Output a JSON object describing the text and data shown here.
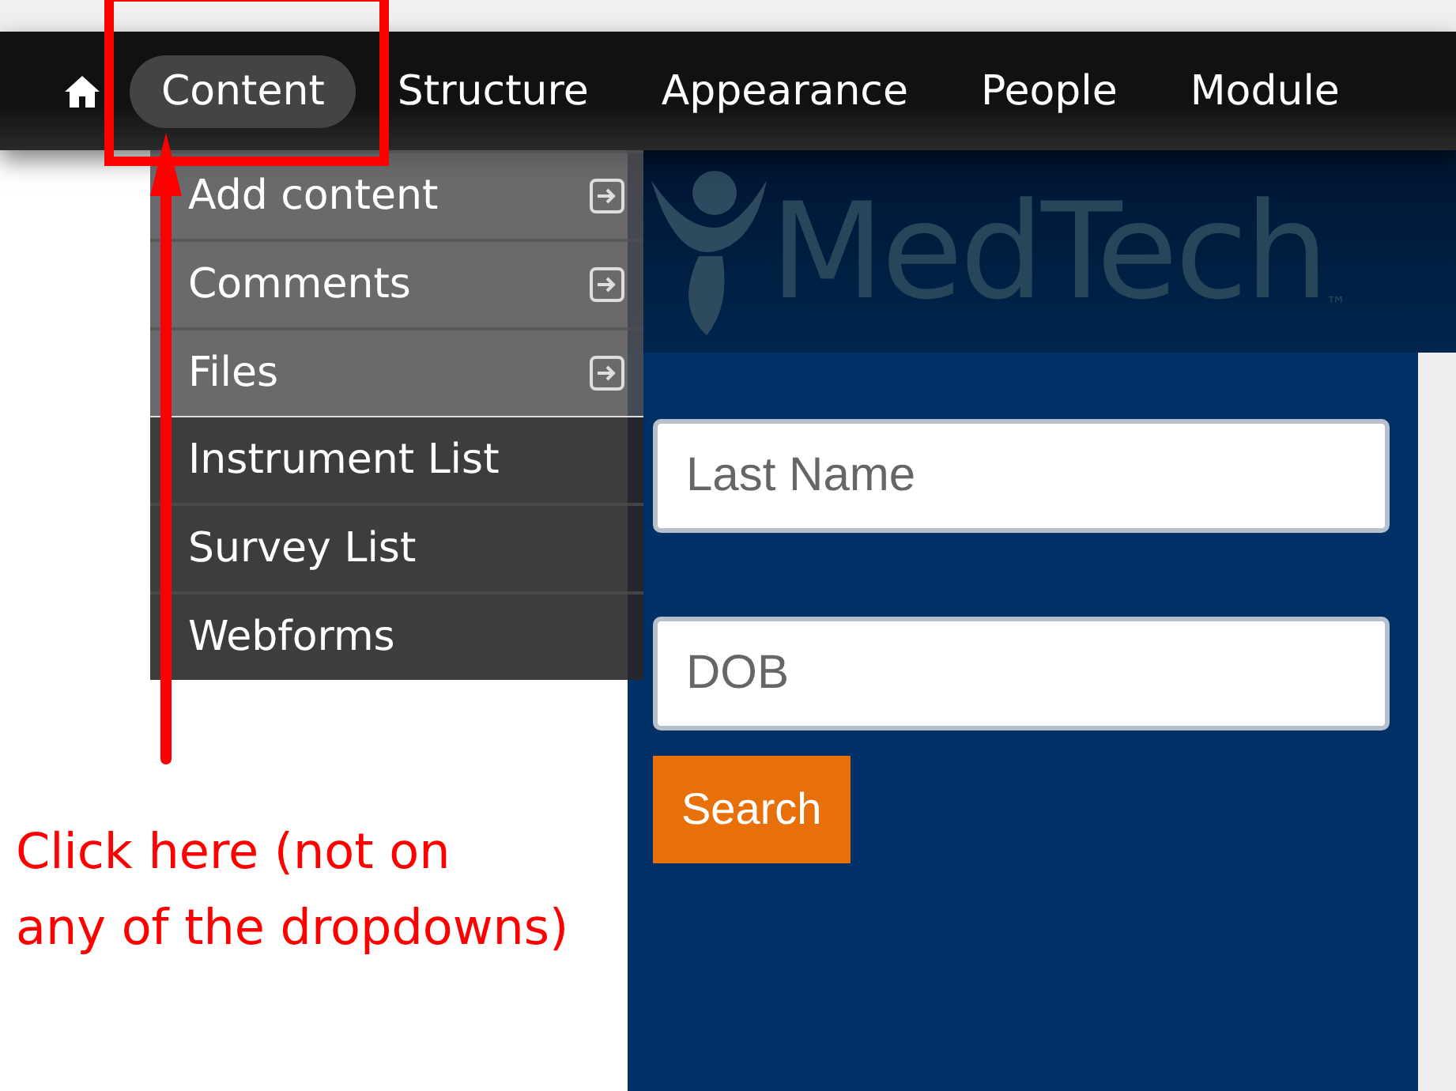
{
  "toolbar": {
    "items": [
      {
        "label": "Content",
        "selected": true
      },
      {
        "label": "Structure",
        "selected": false
      },
      {
        "label": "Appearance",
        "selected": false
      },
      {
        "label": "People",
        "selected": false
      },
      {
        "label": "Module",
        "selected": false
      }
    ]
  },
  "dropdown": {
    "items": [
      {
        "label": "Add content",
        "kind": "expandable"
      },
      {
        "label": "Comments",
        "kind": "expandable"
      },
      {
        "label": "Files",
        "kind": "expandable"
      },
      {
        "label": "Instrument List",
        "kind": "plain"
      },
      {
        "label": "Survey List",
        "kind": "plain"
      },
      {
        "label": "Webforms",
        "kind": "plain"
      }
    ]
  },
  "banner": {
    "logo_text": "MedTech",
    "trademark": "™"
  },
  "form": {
    "fields": [
      {
        "placeholder": "Last Name"
      },
      {
        "placeholder": "DOB"
      }
    ],
    "button": "Search"
  },
  "annotation": {
    "lines": [
      "Click here (not on",
      "any of the dropdowns)"
    ]
  }
}
